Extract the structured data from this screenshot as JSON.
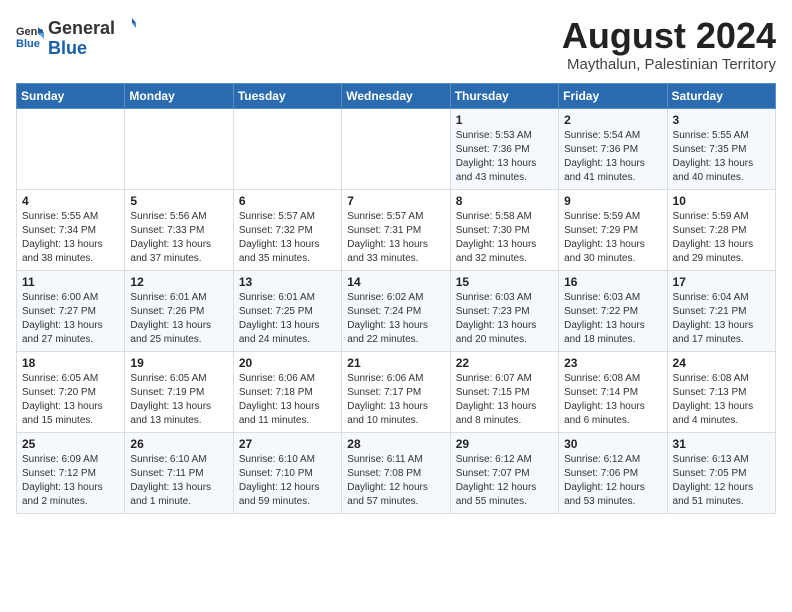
{
  "header": {
    "logo_general": "General",
    "logo_blue": "Blue",
    "month_year": "August 2024",
    "location": "Maythalun, Palestinian Territory"
  },
  "calendar": {
    "days_of_week": [
      "Sunday",
      "Monday",
      "Tuesday",
      "Wednesday",
      "Thursday",
      "Friday",
      "Saturday"
    ],
    "weeks": [
      [
        {
          "day": "",
          "content": ""
        },
        {
          "day": "",
          "content": ""
        },
        {
          "day": "",
          "content": ""
        },
        {
          "day": "",
          "content": ""
        },
        {
          "day": "1",
          "content": "Sunrise: 5:53 AM\nSunset: 7:36 PM\nDaylight: 13 hours and 43 minutes."
        },
        {
          "day": "2",
          "content": "Sunrise: 5:54 AM\nSunset: 7:36 PM\nDaylight: 13 hours and 41 minutes."
        },
        {
          "day": "3",
          "content": "Sunrise: 5:55 AM\nSunset: 7:35 PM\nDaylight: 13 hours and 40 minutes."
        }
      ],
      [
        {
          "day": "4",
          "content": "Sunrise: 5:55 AM\nSunset: 7:34 PM\nDaylight: 13 hours and 38 minutes."
        },
        {
          "day": "5",
          "content": "Sunrise: 5:56 AM\nSunset: 7:33 PM\nDaylight: 13 hours and 37 minutes."
        },
        {
          "day": "6",
          "content": "Sunrise: 5:57 AM\nSunset: 7:32 PM\nDaylight: 13 hours and 35 minutes."
        },
        {
          "day": "7",
          "content": "Sunrise: 5:57 AM\nSunset: 7:31 PM\nDaylight: 13 hours and 33 minutes."
        },
        {
          "day": "8",
          "content": "Sunrise: 5:58 AM\nSunset: 7:30 PM\nDaylight: 13 hours and 32 minutes."
        },
        {
          "day": "9",
          "content": "Sunrise: 5:59 AM\nSunset: 7:29 PM\nDaylight: 13 hours and 30 minutes."
        },
        {
          "day": "10",
          "content": "Sunrise: 5:59 AM\nSunset: 7:28 PM\nDaylight: 13 hours and 29 minutes."
        }
      ],
      [
        {
          "day": "11",
          "content": "Sunrise: 6:00 AM\nSunset: 7:27 PM\nDaylight: 13 hours and 27 minutes."
        },
        {
          "day": "12",
          "content": "Sunrise: 6:01 AM\nSunset: 7:26 PM\nDaylight: 13 hours and 25 minutes."
        },
        {
          "day": "13",
          "content": "Sunrise: 6:01 AM\nSunset: 7:25 PM\nDaylight: 13 hours and 24 minutes."
        },
        {
          "day": "14",
          "content": "Sunrise: 6:02 AM\nSunset: 7:24 PM\nDaylight: 13 hours and 22 minutes."
        },
        {
          "day": "15",
          "content": "Sunrise: 6:03 AM\nSunset: 7:23 PM\nDaylight: 13 hours and 20 minutes."
        },
        {
          "day": "16",
          "content": "Sunrise: 6:03 AM\nSunset: 7:22 PM\nDaylight: 13 hours and 18 minutes."
        },
        {
          "day": "17",
          "content": "Sunrise: 6:04 AM\nSunset: 7:21 PM\nDaylight: 13 hours and 17 minutes."
        }
      ],
      [
        {
          "day": "18",
          "content": "Sunrise: 6:05 AM\nSunset: 7:20 PM\nDaylight: 13 hours and 15 minutes."
        },
        {
          "day": "19",
          "content": "Sunrise: 6:05 AM\nSunset: 7:19 PM\nDaylight: 13 hours and 13 minutes."
        },
        {
          "day": "20",
          "content": "Sunrise: 6:06 AM\nSunset: 7:18 PM\nDaylight: 13 hours and 11 minutes."
        },
        {
          "day": "21",
          "content": "Sunrise: 6:06 AM\nSunset: 7:17 PM\nDaylight: 13 hours and 10 minutes."
        },
        {
          "day": "22",
          "content": "Sunrise: 6:07 AM\nSunset: 7:15 PM\nDaylight: 13 hours and 8 minutes."
        },
        {
          "day": "23",
          "content": "Sunrise: 6:08 AM\nSunset: 7:14 PM\nDaylight: 13 hours and 6 minutes."
        },
        {
          "day": "24",
          "content": "Sunrise: 6:08 AM\nSunset: 7:13 PM\nDaylight: 13 hours and 4 minutes."
        }
      ],
      [
        {
          "day": "25",
          "content": "Sunrise: 6:09 AM\nSunset: 7:12 PM\nDaylight: 13 hours and 2 minutes."
        },
        {
          "day": "26",
          "content": "Sunrise: 6:10 AM\nSunset: 7:11 PM\nDaylight: 13 hours and 1 minute."
        },
        {
          "day": "27",
          "content": "Sunrise: 6:10 AM\nSunset: 7:10 PM\nDaylight: 12 hours and 59 minutes."
        },
        {
          "day": "28",
          "content": "Sunrise: 6:11 AM\nSunset: 7:08 PM\nDaylight: 12 hours and 57 minutes."
        },
        {
          "day": "29",
          "content": "Sunrise: 6:12 AM\nSunset: 7:07 PM\nDaylight: 12 hours and 55 minutes."
        },
        {
          "day": "30",
          "content": "Sunrise: 6:12 AM\nSunset: 7:06 PM\nDaylight: 12 hours and 53 minutes."
        },
        {
          "day": "31",
          "content": "Sunrise: 6:13 AM\nSunset: 7:05 PM\nDaylight: 12 hours and 51 minutes."
        }
      ]
    ]
  }
}
